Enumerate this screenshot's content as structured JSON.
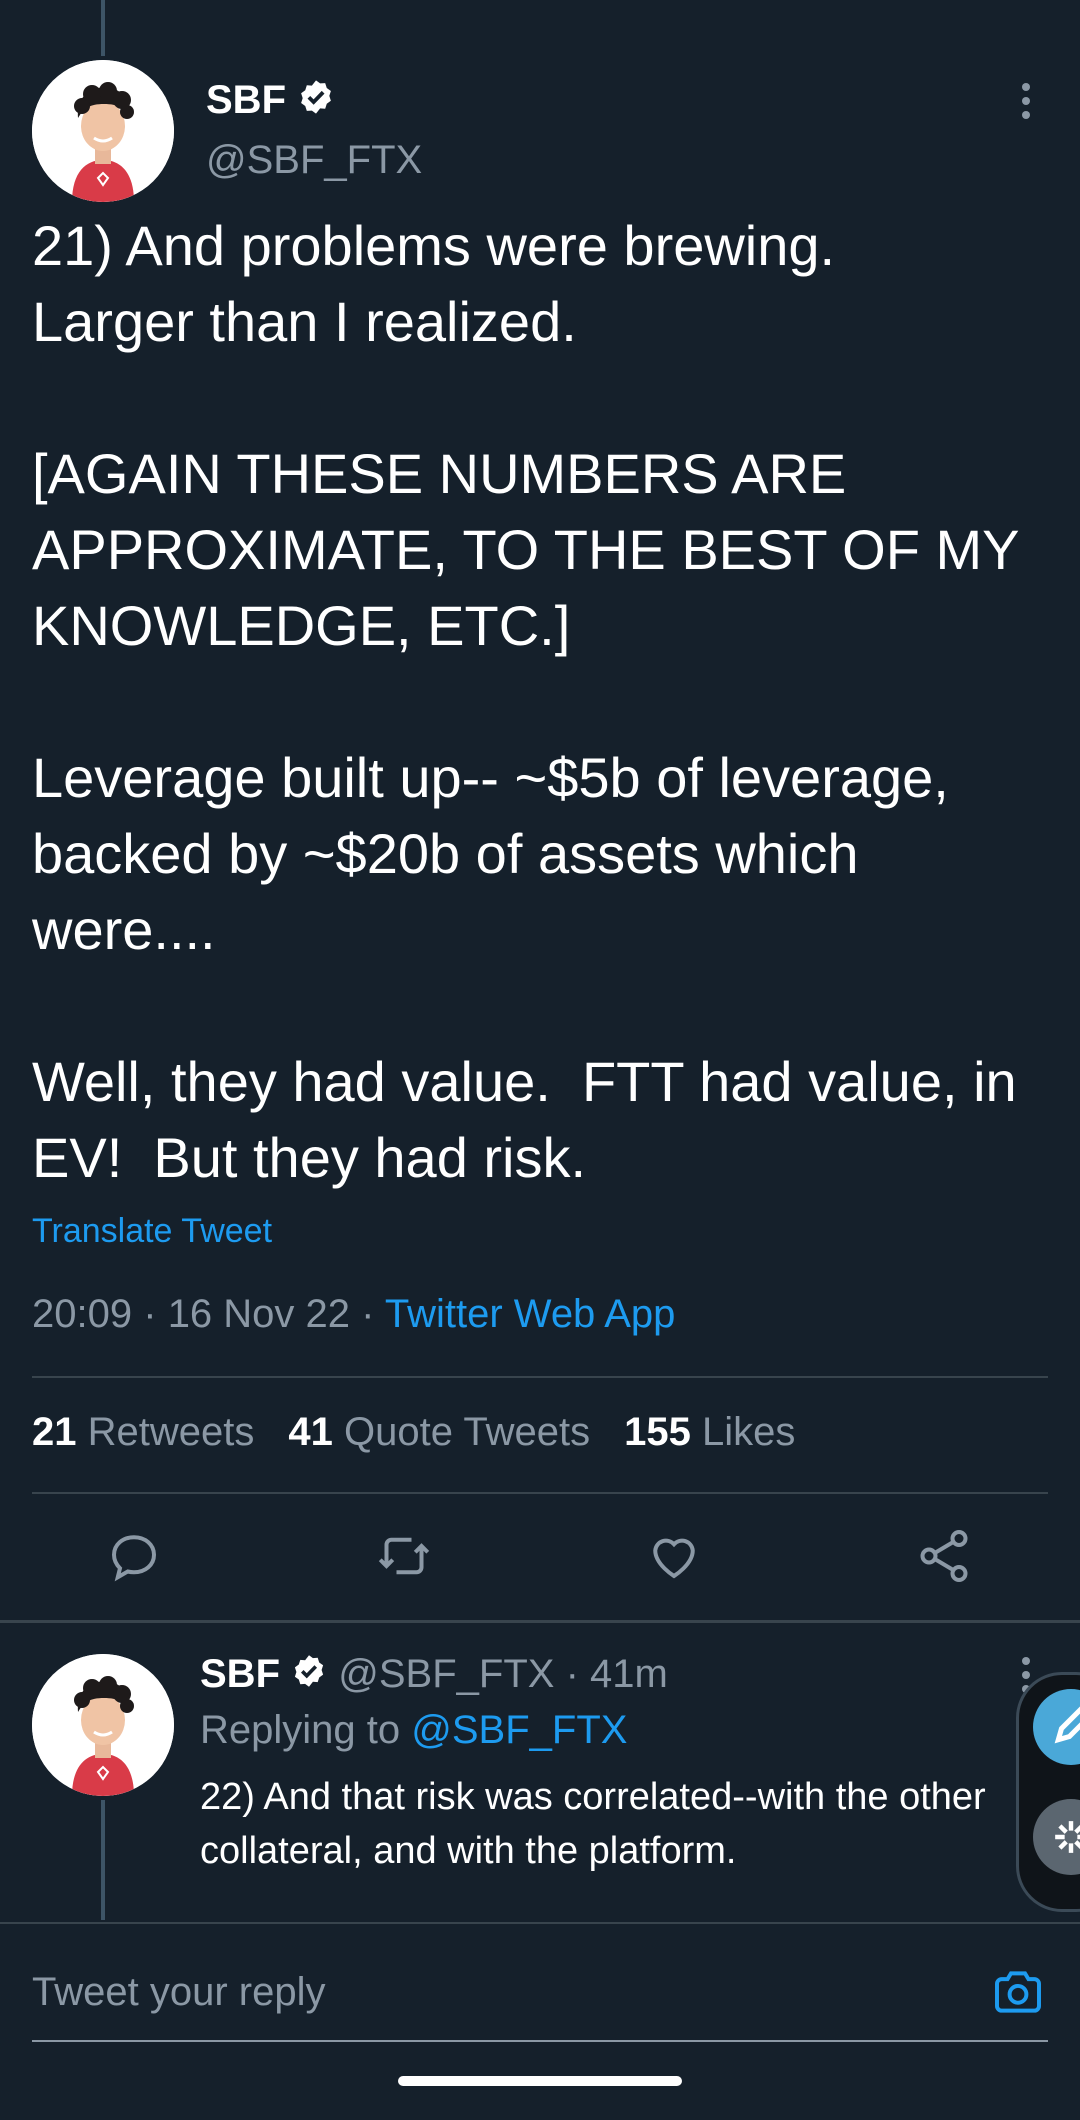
{
  "tweet": {
    "author_name": "SBF",
    "author_handle": "@SBF_FTX",
    "body": "21) And problems were brewing.\nLarger than I realized.\n\n[AGAIN THESE NUMBERS ARE APPROXIMATE, TO THE BEST OF MY KNOWLEDGE, ETC.]\n\nLeverage built up-- ~$5b of leverage, backed by ~$20b of assets which were....\n\nWell, they had value.  FTT had value, in EV!  But they had risk.",
    "translate_label": "Translate Tweet",
    "time": "20:09",
    "date": "16 Nov 22",
    "source": "Twitter Web App",
    "separator": "·",
    "stats": {
      "retweets_count": "21",
      "retweets_label": "Retweets",
      "quotes_count": "41",
      "quotes_label": "Quote Tweets",
      "likes_count": "155",
      "likes_label": "Likes"
    },
    "actions": [
      "reply-icon",
      "retweet-icon",
      "like-icon",
      "share-icon"
    ]
  },
  "reply": {
    "author_name": "SBF",
    "author_handle": "@SBF_FTX",
    "age": "41m",
    "separator": "·",
    "replying_label": "Replying to",
    "replying_to": "@SBF_FTX",
    "text": "22) And that risk was correlated--with the other collateral, and with the platform."
  },
  "composer": {
    "placeholder": "Tweet your reply",
    "camera_icon": "camera-icon"
  },
  "colors": {
    "background": "#15202b",
    "accent": "#1d9bf0",
    "muted": "#8b98a5",
    "divider": "#38444d",
    "fab_compose": "#4aa8d8"
  }
}
